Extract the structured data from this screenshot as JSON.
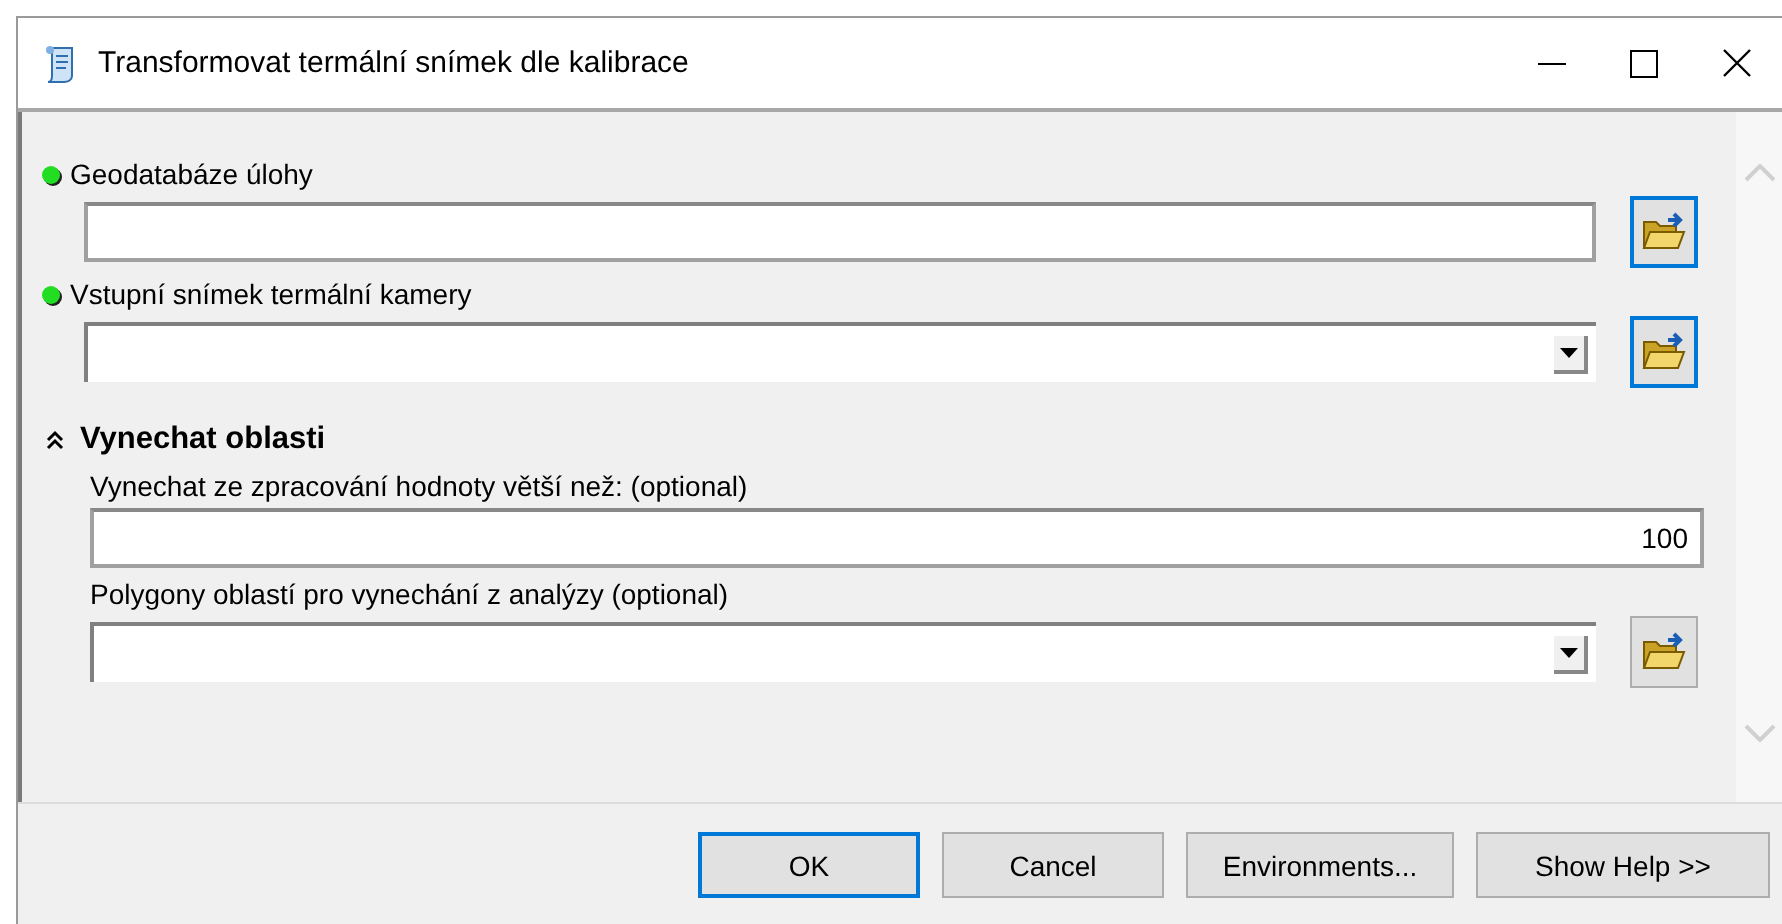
{
  "window": {
    "title": "Transformovat termální snímek dle kalibrace"
  },
  "parameters": [
    {
      "label": "Geodatabáze úlohy",
      "required": true,
      "kind": "text",
      "browse": true,
      "browse_focused": true
    },
    {
      "label": "Vstupní snímek termální kamery",
      "required": true,
      "kind": "dropdown",
      "browse": true,
      "browse_focused": true
    }
  ],
  "section": {
    "title": "Vynechat oblasti",
    "expanded": true,
    "parameters": [
      {
        "label": "Vynechat ze zpracování hodnoty větší než: (optional)",
        "required": false,
        "kind": "text",
        "value": "100",
        "browse": false
      },
      {
        "label": "Polygony oblastí pro vynechání z analýzy (optional)",
        "required": false,
        "kind": "dropdown",
        "browse": true,
        "browse_focused": false
      }
    ]
  },
  "buttons": [
    {
      "label": "OK",
      "default": true
    },
    {
      "label": "Cancel",
      "default": false
    },
    {
      "label": "Environments...",
      "default": false
    },
    {
      "label": "Show Help >>",
      "default": false
    }
  ]
}
